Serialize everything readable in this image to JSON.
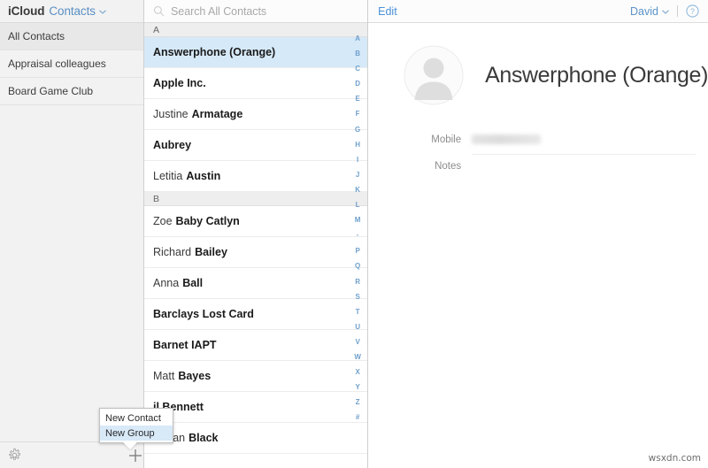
{
  "app": {
    "brand": "iCloud",
    "section": "Contacts",
    "chevron": "⌄"
  },
  "sidebar": {
    "groups": [
      {
        "label": "All Contacts",
        "selected": true
      },
      {
        "label": "Appraisal colleagues",
        "selected": false
      },
      {
        "label": "Board Game Club",
        "selected": false
      }
    ],
    "settings_icon": "gear-icon"
  },
  "search": {
    "placeholder": "Search All Contacts",
    "icon": "search-icon"
  },
  "contact_list": {
    "sections": [
      {
        "letter": "A",
        "contacts": [
          {
            "first": "",
            "last": "Answerphone (Orange)",
            "selected": true
          },
          {
            "first": "",
            "last": "Apple Inc.",
            "selected": false
          },
          {
            "first": "Justine",
            "last": "Armatage",
            "selected": false
          },
          {
            "first": "",
            "last": "Aubrey",
            "selected": false
          },
          {
            "first": "Letitia",
            "last": "Austin",
            "selected": false
          }
        ]
      },
      {
        "letter": "B",
        "contacts": [
          {
            "first": "Zoe",
            "last": "Baby Catlyn",
            "selected": false
          },
          {
            "first": "Richard",
            "last": "Bailey",
            "selected": false
          },
          {
            "first": "Anna",
            "last": "Ball",
            "selected": false
          },
          {
            "first": "",
            "last": "Barclays Lost Card",
            "selected": false
          },
          {
            "first": "",
            "last": "Barnet IAPT",
            "selected": false
          },
          {
            "first": "Matt",
            "last": "Bayes",
            "selected": false
          },
          {
            "first": "",
            "last": "il Bennett",
            "selected": false
          },
          {
            "first": "Adrian",
            "last": "Black",
            "selected": false
          }
        ]
      }
    ],
    "index": [
      "A",
      "B",
      "C",
      "D",
      "E",
      "F",
      "G",
      "H",
      "I",
      "J",
      "K",
      "L",
      "M",
      "·",
      "P",
      "Q",
      "R",
      "S",
      "T",
      "U",
      "V",
      "W",
      "X",
      "Y",
      "Z",
      "#"
    ]
  },
  "popup_menu": {
    "items": [
      {
        "label": "New Contact",
        "highlighted": false
      },
      {
        "label": "New Group",
        "highlighted": true
      }
    ]
  },
  "toolbar": {
    "plus_label": "+",
    "add_icon": "plus-icon"
  },
  "detail": {
    "edit_label": "Edit",
    "account_name": "David",
    "account_chevron": "⌄",
    "help_icon": "help-circle-icon",
    "avatar_icon": "person-avatar-icon",
    "contact_name": "Answerphone (Orange)",
    "fields": [
      {
        "label": "Mobile",
        "value": "",
        "redacted": true
      },
      {
        "label": "Notes",
        "value": "",
        "redacted": false
      }
    ]
  },
  "watermark": {
    "text": "wsxdn.com"
  },
  "colors": {
    "accent_blue": "#4a90d9",
    "selected_row": "#d6e9f8",
    "sidebar_bg": "#f2f2f2",
    "section_header_bg": "#eeeeee",
    "index_letter": "#6fa0cc"
  }
}
